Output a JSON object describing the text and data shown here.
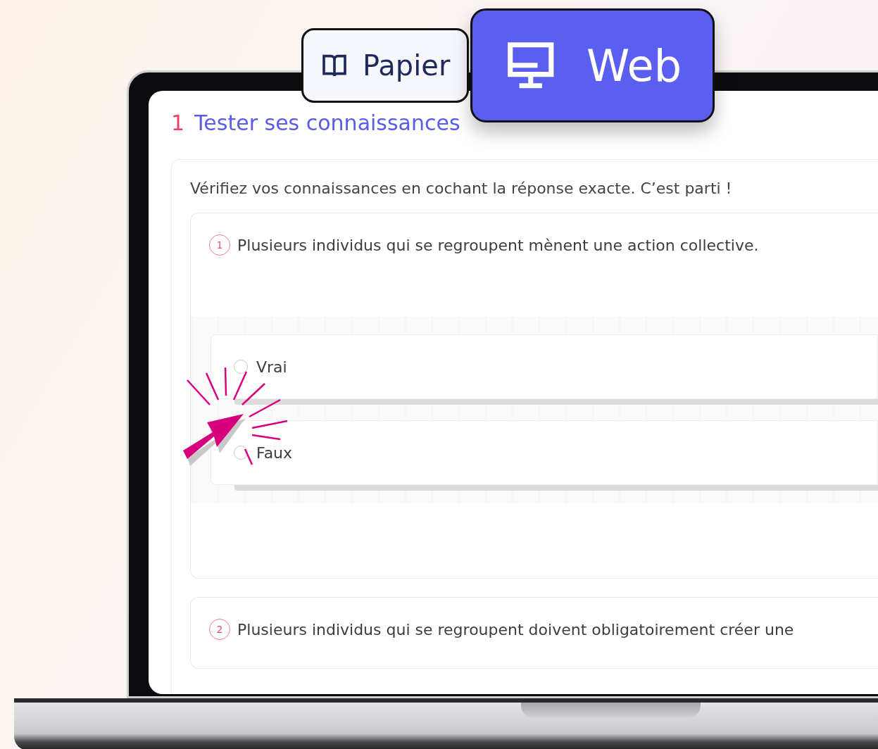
{
  "mode_toggle": [
    {
      "label": "Papier",
      "kind": "book",
      "selected": false
    },
    {
      "label": "Web",
      "kind": "monitor",
      "selected": true
    }
  ],
  "section": {
    "number": "1",
    "title": "Tester ses connaissances"
  },
  "instructions": "Vérifiez vos connaissances en cochant la réponse exacte. C’est parti !",
  "questions": [
    {
      "number": "1",
      "text": "Plusieurs individus qui se regroupent mènent une action collective.",
      "options": [
        {
          "label": "Vrai",
          "checked": false
        },
        {
          "label": "Faux",
          "checked": false
        }
      ]
    },
    {
      "number": "2",
      "text": "Plusieurs individus qui se regroupent doivent obligatoirement créer une"
    }
  ]
}
